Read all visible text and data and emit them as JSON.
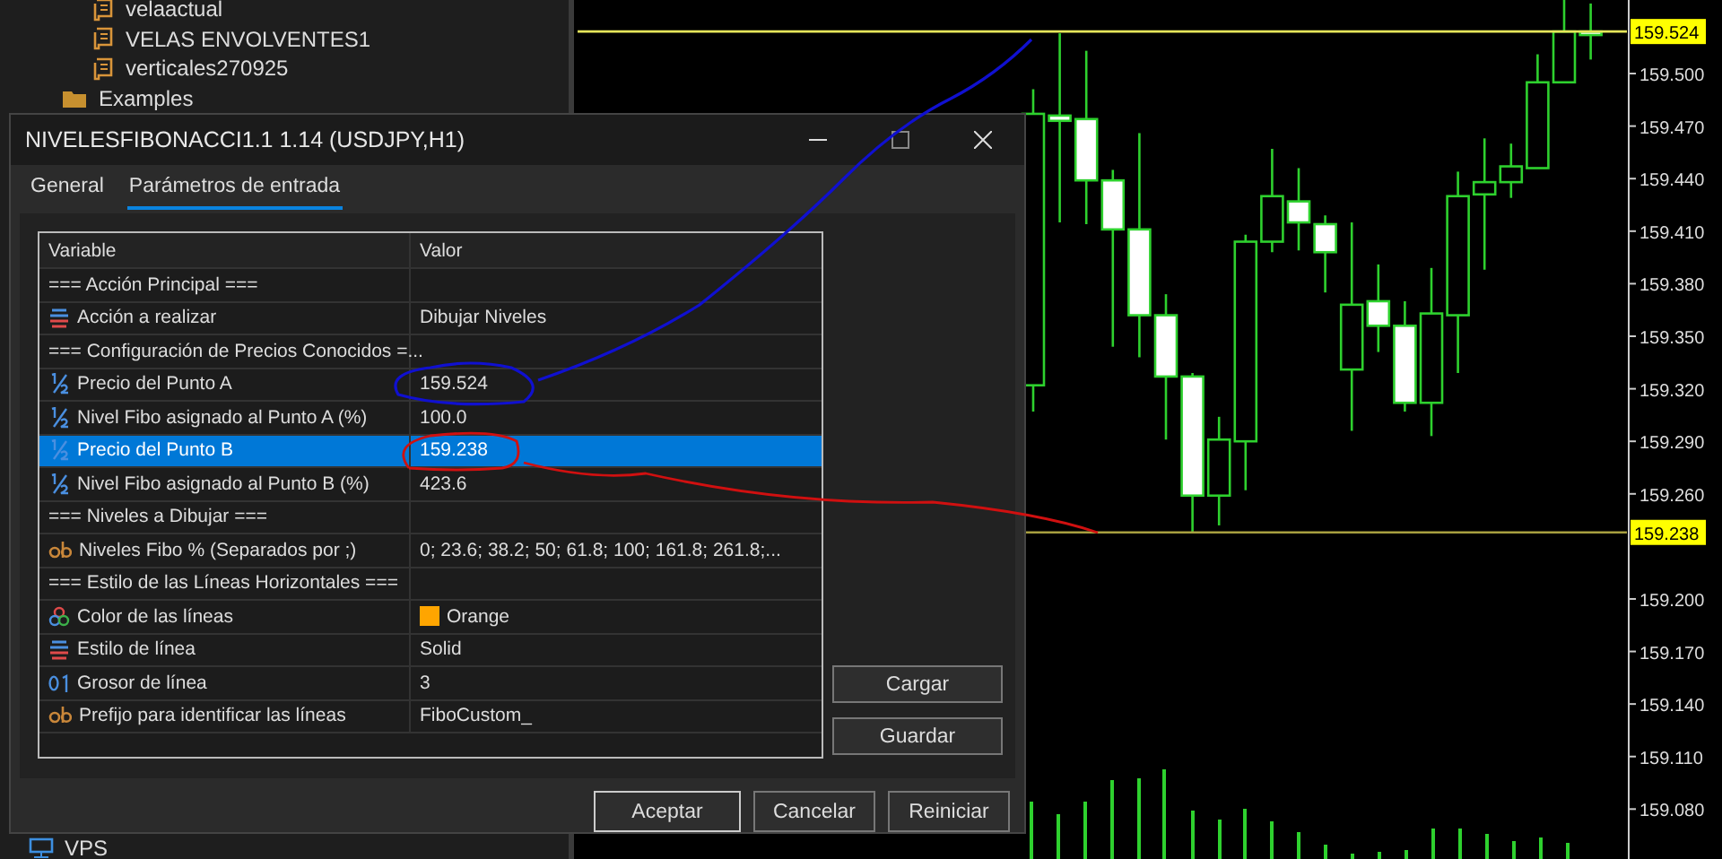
{
  "navigator": {
    "items": [
      {
        "kind": "script",
        "label": "velaactual"
      },
      {
        "kind": "script",
        "label": "VELAS ENVOLVENTES1"
      },
      {
        "kind": "script",
        "label": "verticales270925"
      },
      {
        "kind": "folder",
        "label": "Examples"
      }
    ],
    "footer_item": {
      "kind": "service",
      "label": "VPS"
    }
  },
  "chart": {
    "chart_data": {
      "type": "candlestick",
      "ohlc": [
        [
          159.322,
          159.491,
          159.307,
          159.477
        ],
        [
          159.476,
          159.523,
          159.415,
          159.473
        ],
        [
          159.474,
          159.513,
          159.414,
          159.439
        ],
        [
          159.439,
          159.445,
          159.344,
          159.411
        ],
        [
          159.411,
          159.466,
          159.338,
          159.362
        ],
        [
          159.362,
          159.374,
          159.291,
          159.327
        ],
        [
          159.327,
          159.329,
          159.238,
          159.259
        ],
        [
          159.259,
          159.304,
          159.242,
          159.291
        ],
        [
          159.29,
          159.408,
          159.262,
          159.404
        ],
        [
          159.404,
          159.457,
          159.398,
          159.43
        ],
        [
          159.427,
          159.446,
          159.399,
          159.415
        ],
        [
          159.414,
          159.419,
          159.375,
          159.398
        ],
        [
          159.331,
          159.415,
          159.296,
          159.368
        ],
        [
          159.37,
          159.391,
          159.341,
          159.356
        ],
        [
          159.356,
          159.37,
          159.307,
          159.312
        ],
        [
          159.312,
          159.389,
          159.293,
          159.363
        ],
        [
          159.362,
          159.444,
          159.329,
          159.43
        ],
        [
          159.431,
          159.463,
          159.388,
          159.438
        ],
        [
          159.438,
          159.46,
          159.429,
          159.447
        ],
        [
          159.446,
          159.511,
          159.446,
          159.495
        ],
        [
          159.495,
          159.542,
          159.495,
          159.524
        ],
        [
          159.524,
          159.54,
          159.508,
          159.522
        ]
      ],
      "ylim": [
        159.0515,
        159.542
      ],
      "yticks": [
        {
          "value": 159.5,
          "label": "159.500"
        },
        {
          "value": 159.47,
          "label": "159.470"
        },
        {
          "value": 159.44,
          "label": "159.440"
        },
        {
          "value": 159.41,
          "label": "159.410"
        },
        {
          "value": 159.38,
          "label": "159.380"
        },
        {
          "value": 159.35,
          "label": "159.350"
        },
        {
          "value": 159.32,
          "label": "159.320"
        },
        {
          "value": 159.29,
          "label": "159.290"
        },
        {
          "value": 159.26,
          "label": "159.260"
        },
        {
          "value": 159.2,
          "label": "159.200"
        },
        {
          "value": 159.17,
          "label": "159.170"
        },
        {
          "value": 159.14,
          "label": "159.140"
        },
        {
          "value": 159.11,
          "label": "159.110"
        },
        {
          "value": 159.08,
          "label": "159.080"
        }
      ]
    },
    "price_tags": [
      {
        "label": "159.524",
        "kind": "upper"
      },
      {
        "label": "159.238",
        "kind": "lower"
      }
    ]
  },
  "dialog": {
    "title": "NIVELESFIBONACCI1.1 1.14 (USDJPY,H1)",
    "tabs": [
      {
        "label": "General",
        "selected": false
      },
      {
        "label": "Parámetros de entrada",
        "selected": true
      }
    ],
    "table": {
      "columns": [
        "Variable",
        "Valor"
      ],
      "rows": [
        {
          "kind": "section",
          "variable": "=== Acción Principal ===",
          "selected": false
        },
        {
          "kind": "enum",
          "variable": "Acción a realizar",
          "value": "Dibujar Niveles",
          "selected": false
        },
        {
          "kind": "section",
          "variable": "=== Configuración de Precios Conocidos =...",
          "selected": false
        },
        {
          "kind": "double",
          "variable": "Precio del Punto A",
          "value": "159.524",
          "selected": false
        },
        {
          "kind": "double",
          "variable": "Nivel Fibo asignado al Punto A (%)",
          "value": "100.0",
          "selected": false
        },
        {
          "kind": "double",
          "variable": "Precio del Punto B",
          "value": "159.238",
          "selected": true
        },
        {
          "kind": "double",
          "variable": "Nivel Fibo asignado al Punto B (%)",
          "value": "423.6",
          "selected": false
        },
        {
          "kind": "section",
          "variable": "=== Niveles a Dibujar ===",
          "selected": false
        },
        {
          "kind": "string",
          "variable": "Niveles Fibo % (Separados por ;)",
          "value": "0; 23.6; 38.2; 50; 61.8; 100; 161.8; 261.8;...",
          "selected": false
        },
        {
          "kind": "section",
          "variable": "=== Estilo de las Líneas Horizontales ===",
          "selected": false
        },
        {
          "kind": "color",
          "variable": "Color de las líneas",
          "value": "Orange",
          "color": "#ffa500",
          "selected": false
        },
        {
          "kind": "enum",
          "variable": "Estilo de línea",
          "value": "Solid",
          "selected": false
        },
        {
          "kind": "int",
          "variable": "Grosor de línea",
          "value": "3",
          "selected": false
        },
        {
          "kind": "string",
          "variable": "Prefijo para identificar las líneas",
          "value": "FiboCustom_",
          "selected": false
        }
      ]
    },
    "side_buttons": [
      "Cargar",
      "Guardar"
    ],
    "buttons": [
      "Aceptar",
      "Cancelar",
      "Reiniciar"
    ]
  }
}
